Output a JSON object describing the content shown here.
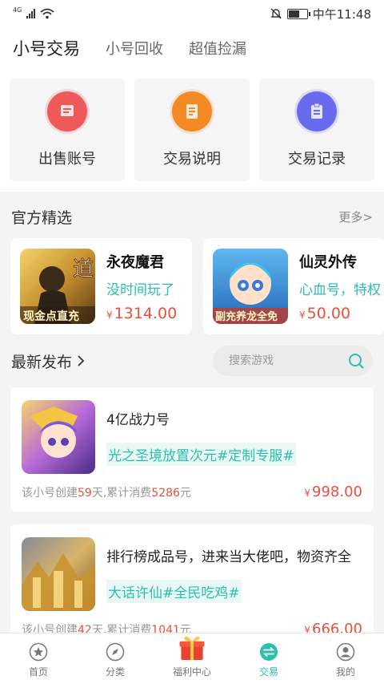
{
  "status": {
    "time": "中午11:48",
    "network": "4G"
  },
  "tabs": [
    "小号交易",
    "小号回收",
    "超值捡漏"
  ],
  "quick_actions": [
    {
      "label": "出售账号",
      "icon": "sell-account-icon",
      "color": "#f15a5a"
    },
    {
      "label": "交易说明",
      "icon": "trade-guide-icon",
      "color": "#f48a25"
    },
    {
      "label": "交易记录",
      "icon": "trade-record-icon",
      "color": "#6a6cf0"
    }
  ],
  "featured": {
    "title": "官方精选",
    "more": "更多>",
    "items": [
      {
        "name": "永夜魔君",
        "desc": "没时间玩了",
        "price_symbol": "¥",
        "price": "1314.00",
        "banner": "现金点直充"
      },
      {
        "name": "仙灵外传",
        "desc": "心血号，特权",
        "price_symbol": "¥",
        "price": "50.00",
        "banner": "副充养龙全免"
      }
    ]
  },
  "latest": {
    "title": "最新发布",
    "search_placeholder": "搜索游戏",
    "items": [
      {
        "title": "4亿战力号",
        "tags": "光之圣境放置次元#定制专服#",
        "stats_prefix": "该小号创建",
        "days": "59",
        "stats_mid": "天,累计消费",
        "spend": "5286",
        "stats_suffix": "元",
        "price_symbol": "¥",
        "price": "998.00"
      },
      {
        "title": "排行榜成品号，进来当大佬吧，物资齐全",
        "tags": "大话许仙#全民吃鸡#",
        "stats_prefix": "该小号创建",
        "days": "42",
        "stats_mid": "天,累计消费",
        "spend": "1041",
        "stats_suffix": "元",
        "price_symbol": "¥",
        "price": "666.00"
      }
    ]
  },
  "bottom_nav": [
    "首页",
    "分类",
    "福利中心",
    "交易",
    "我的"
  ],
  "colors": {
    "accent": "#2bbfae",
    "price": "#e9503d"
  }
}
